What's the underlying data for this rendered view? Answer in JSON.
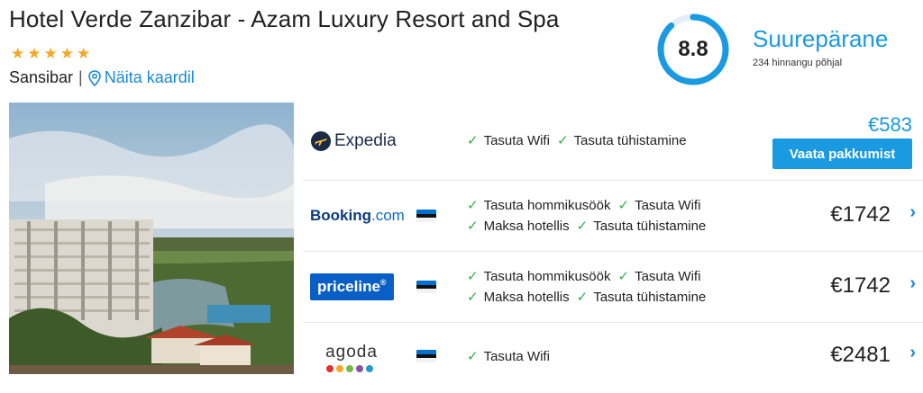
{
  "hotel": {
    "name": "Hotel Verde Zanzibar - Azam Luxury Resort and Spa",
    "stars": "★★★★★",
    "location": "Sansibar",
    "separator": "|",
    "map_link": "Näita kaardil"
  },
  "rating": {
    "score": "8.8",
    "score_fraction": 0.88,
    "label": "Suurepärane",
    "count": "234 hinnangu põhjal",
    "accent": "#1a9ae0"
  },
  "offers": [
    {
      "provider": "Expedia",
      "features": [
        "Tasuta Wifi",
        "Tasuta tühistamine"
      ],
      "price": "€583",
      "button": "Vaata pakkumist"
    },
    {
      "provider": "Booking.com",
      "provider_parts": [
        "Booking",
        ".com"
      ],
      "features_row1": [
        "Tasuta hommikusöök",
        "Tasuta Wifi"
      ],
      "features_row2": [
        "Maksa hotellis",
        "Tasuta tühistamine"
      ],
      "price": "€1742",
      "chevron": "›"
    },
    {
      "provider": "priceline",
      "provider_suffix": "®",
      "features_row1": [
        "Tasuta hommikusöök",
        "Tasuta Wifi"
      ],
      "features_row2": [
        "Maksa hotellis",
        "Tasuta tühistamine"
      ],
      "price": "€1742",
      "chevron": "›"
    },
    {
      "provider": "agoda",
      "features": [
        "Tasuta Wifi"
      ],
      "price": "€2481",
      "chevron": "›"
    }
  ],
  "check_glyph": "✓",
  "colors": {
    "star": "#f5a623",
    "link": "#1a8ad8",
    "check": "#2eae4b",
    "button": "#1a9ae0"
  }
}
